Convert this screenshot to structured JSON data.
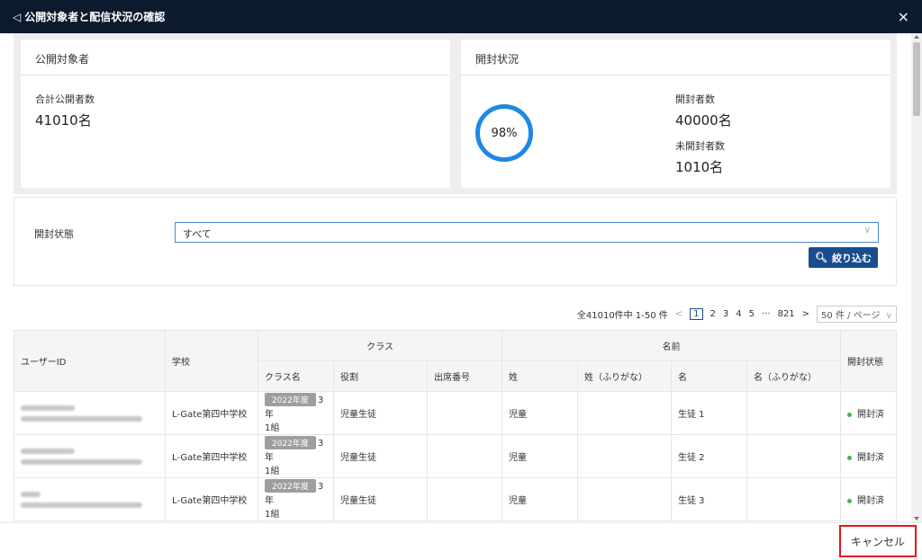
{
  "titlebar": {
    "title": "公開対象者と配信状況の確認",
    "back_glyph": "◁",
    "close_glyph": "×"
  },
  "summary": {
    "audience": {
      "heading": "公開対象者",
      "label": "合計公開者数",
      "value": "41010名"
    },
    "status": {
      "heading": "開封状況",
      "percent": "98%",
      "opened_label": "開封者数",
      "opened_value": "40000名",
      "unopened_label": "未開封者数",
      "unopened_value": "1010名",
      "ring_color": "#1e88e5"
    }
  },
  "filter": {
    "label": "開封状態",
    "selected": "すべて",
    "button_label": "絞り込む"
  },
  "pager": {
    "summary": "全41010件中 1-50 件",
    "prev": "<",
    "pages": [
      "1",
      "2",
      "3",
      "4",
      "5",
      "···",
      "821"
    ],
    "next": ">",
    "page_size": "50 件 / ページ"
  },
  "table": {
    "headers": {
      "user_id": "ユーザーID",
      "school": "学校",
      "class_group": "クラス",
      "name_group": "名前",
      "status": "開封状態",
      "class_name": "クラス名",
      "role": "役割",
      "seat_no": "出席番号",
      "last": "姓",
      "last_kana": "姓（ふりがな）",
      "first": "名",
      "first_kana": "名（ふりがな）"
    },
    "rows": [
      {
        "school": "L-Gate第四中学校",
        "year_badge": "2022年度",
        "class_suffix": "3年",
        "class_line2": "1組",
        "role": "児童生徒",
        "seat_no": "",
        "last": "児童",
        "last_kana": "",
        "first": "生徒 1",
        "first_kana": "",
        "status": "開封済"
      },
      {
        "school": "L-Gate第四中学校",
        "year_badge": "2022年度",
        "class_suffix": "3年",
        "class_line2": "1組",
        "role": "児童生徒",
        "seat_no": "",
        "last": "児童",
        "last_kana": "",
        "first": "生徒 2",
        "first_kana": "",
        "status": "開封済"
      },
      {
        "school": "L-Gate第四中学校",
        "year_badge": "2022年度",
        "class_suffix": "3年",
        "class_line2": "1組",
        "role": "児童生徒",
        "seat_no": "",
        "last": "児童",
        "last_kana": "",
        "first": "生徒 3",
        "first_kana": "",
        "status": "開封済"
      }
    ]
  },
  "footer": {
    "cancel_label": "キャンセル"
  }
}
